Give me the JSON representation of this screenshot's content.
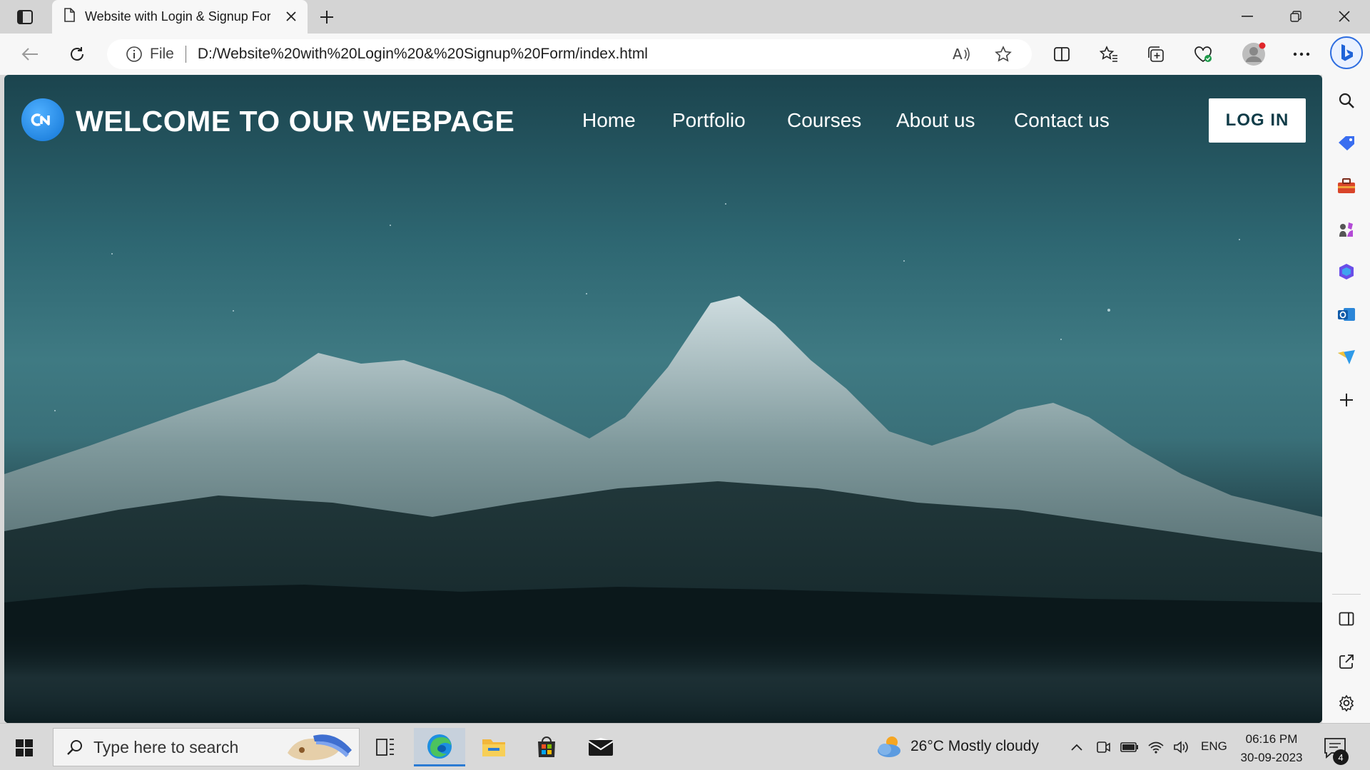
{
  "browser": {
    "tab_title": "Website with Login & Signup For",
    "url_scheme_label": "File",
    "url": "D:/Website%20with%20Login%20&%20Signup%20Form/index.html"
  },
  "page": {
    "site_title": "WELCOME TO OUR WEBPAGE",
    "nav": [
      "Home",
      "Portfolio",
      "Courses",
      "About us",
      "Contact us"
    ],
    "login_label": "LOG IN"
  },
  "sidebar": {
    "icons": [
      "search-icon",
      "tag-icon",
      "toolbox-icon",
      "games-icon",
      "office-icon",
      "outlook-icon",
      "send-icon",
      "add-icon",
      "split-pane-icon",
      "open-external-icon",
      "settings-icon"
    ]
  },
  "taskbar": {
    "search_placeholder": "Type here to search",
    "weather": "26°C  Mostly cloudy",
    "language": "ENG",
    "time": "06:16 PM",
    "date": "30-09-2023",
    "notification_count": "4"
  },
  "colors": {
    "accent": "#2b7bd3",
    "logo": "#1275d6",
    "sky": "#3f7a83"
  }
}
